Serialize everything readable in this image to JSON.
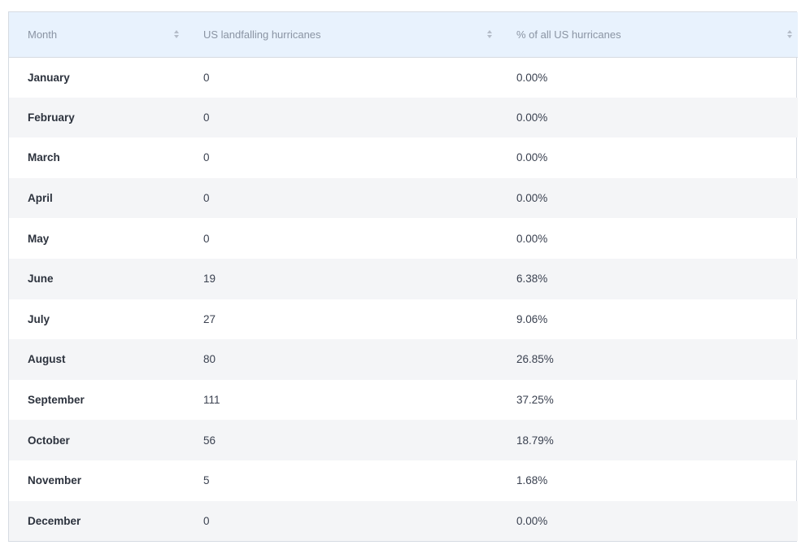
{
  "table": {
    "headers": [
      "Month",
      "US landfalling hurricanes",
      "% of all US hurricanes"
    ],
    "rows": [
      [
        "January",
        "0",
        "0.00%"
      ],
      [
        "February",
        "0",
        "0.00%"
      ],
      [
        "March",
        "0",
        "0.00%"
      ],
      [
        "April",
        "0",
        "0.00%"
      ],
      [
        "May",
        "0",
        "0.00%"
      ],
      [
        "June",
        "19",
        "6.38%"
      ],
      [
        "July",
        "27",
        "9.06%"
      ],
      [
        "August",
        "80",
        "26.85%"
      ],
      [
        "September",
        "111",
        "37.25%"
      ],
      [
        "October",
        "56",
        "18.79%"
      ],
      [
        "November",
        "5",
        "1.68%"
      ],
      [
        "December",
        "0",
        "0.00%"
      ]
    ]
  },
  "colors": {
    "header_bg": "#e8f2fd",
    "stripe_bg": "#f4f5f7",
    "border": "#d6dbe2"
  }
}
